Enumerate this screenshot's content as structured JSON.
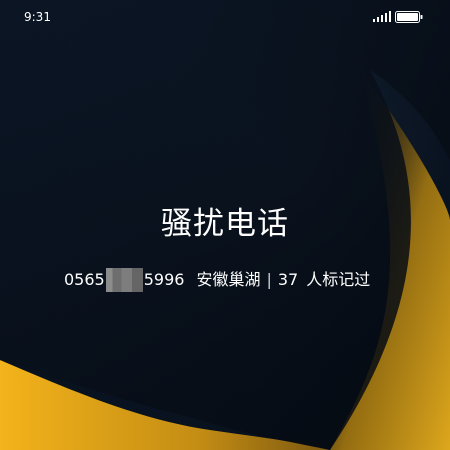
{
  "status_bar": {
    "time": "9:31"
  },
  "call": {
    "title": "骚扰电话",
    "number_prefix": "0565",
    "number_suffix": "5996",
    "location": "安徽巢湖",
    "separator": "|",
    "report_count": "37",
    "report_label": "人标记过"
  },
  "colors": {
    "accent": "#f2b21a",
    "background": "#0b1524",
    "text": "#ffffff"
  },
  "icons": [
    "signal-icon",
    "battery-icon"
  ]
}
